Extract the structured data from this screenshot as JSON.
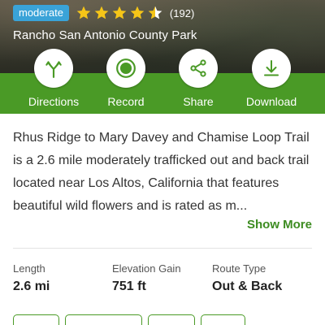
{
  "hero": {
    "difficulty": "moderate",
    "rating_stars": 4.5,
    "review_count": "(192)",
    "park_name": "Rancho San Antonio County Park"
  },
  "actions": [
    {
      "label": "Directions",
      "icon": "directions-icon"
    },
    {
      "label": "Record",
      "icon": "record-icon"
    },
    {
      "label": "Share",
      "icon": "share-icon"
    },
    {
      "label": "Download",
      "icon": "download-icon"
    }
  ],
  "description": {
    "text": "Rhus Ridge to Mary Davey and Chamise Loop Trail is a 2.6 mile moderately trafficked out and back trail located near Los Altos, California that features beautiful wild flowers and is rated as m...",
    "show_more_label": "Show More"
  },
  "stats": [
    {
      "label": "Length",
      "value": "2.6 mi"
    },
    {
      "label": "Elevation Gain",
      "value": "751 ft"
    },
    {
      "label": "Route Type",
      "value": "Out & Back"
    }
  ],
  "colors": {
    "accent_green": "#4a9a26",
    "badge_blue": "#3aa3d8",
    "star_yellow": "#f5c518"
  }
}
